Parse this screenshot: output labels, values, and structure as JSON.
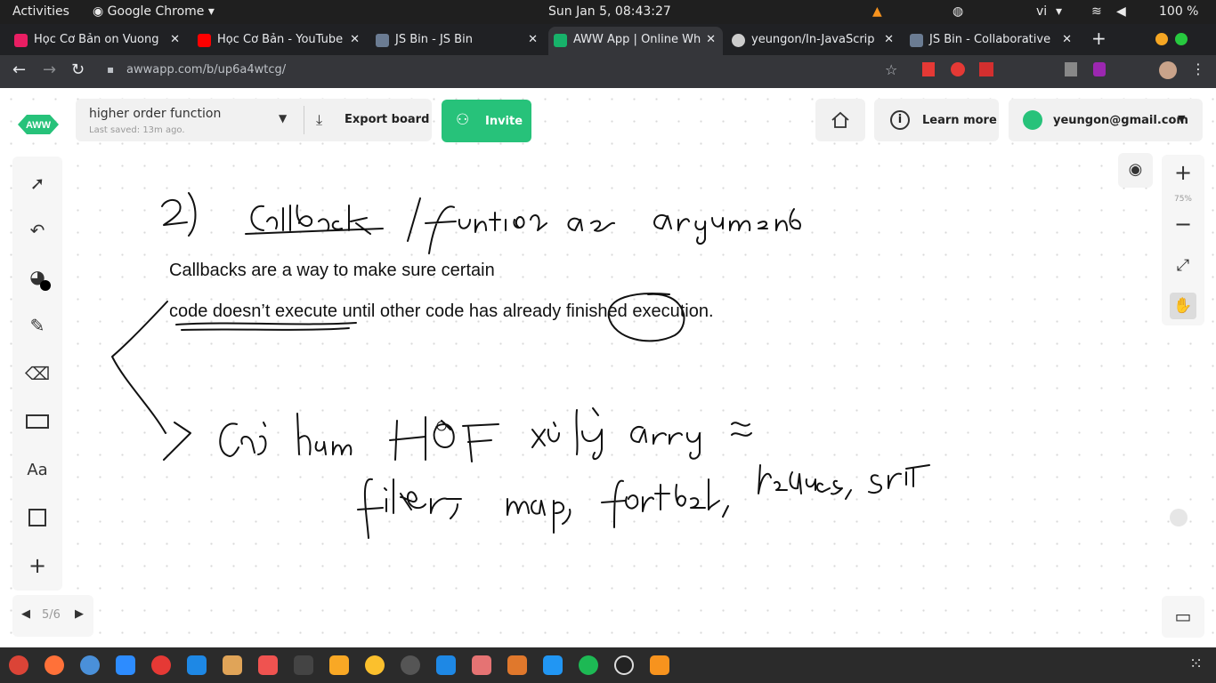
{
  "system": {
    "activities": "Activities",
    "app_name": "Google Chrome",
    "clock": "Sun Jan  5, 08:43:27",
    "lang": "vi",
    "battery": "100 %"
  },
  "tabs": [
    {
      "label": "Học Cơ Bản on Vuong",
      "color": "#e91e63"
    },
    {
      "label": "Học Cơ Bản - YouTube",
      "color": "#ff0000"
    },
    {
      "label": "JS Bin - JS Bin",
      "color": "#6b7c93"
    },
    {
      "label": "AWW App | Online Wh",
      "color": "#17b26a"
    },
    {
      "label": "yeungon/In-JavaScrip",
      "color": "#cccccc"
    },
    {
      "label": "JS Bin - Collaborative",
      "color": "#6b7c93"
    }
  ],
  "browser": {
    "url": "awwapp.com/b/up6a4wtcg/"
  },
  "header": {
    "board_name": "higher order function",
    "last_saved": "Last saved: 13m ago.",
    "export_label": "Export board",
    "invite_label": "Invite",
    "learn_more_label": "Learn more",
    "user_email": "yeungon@gmail.com"
  },
  "canvas": {
    "line1": "Callbacks are a way to make sure certain",
    "line2": "code doesn’t execute until other code has already finished execution."
  },
  "zoom": {
    "level": "75%"
  },
  "pager": {
    "label": "5/6"
  },
  "tools": {
    "text_tool": "Aa"
  },
  "colors": {
    "accent": "#27c27a",
    "annotation": "#d0192b"
  }
}
